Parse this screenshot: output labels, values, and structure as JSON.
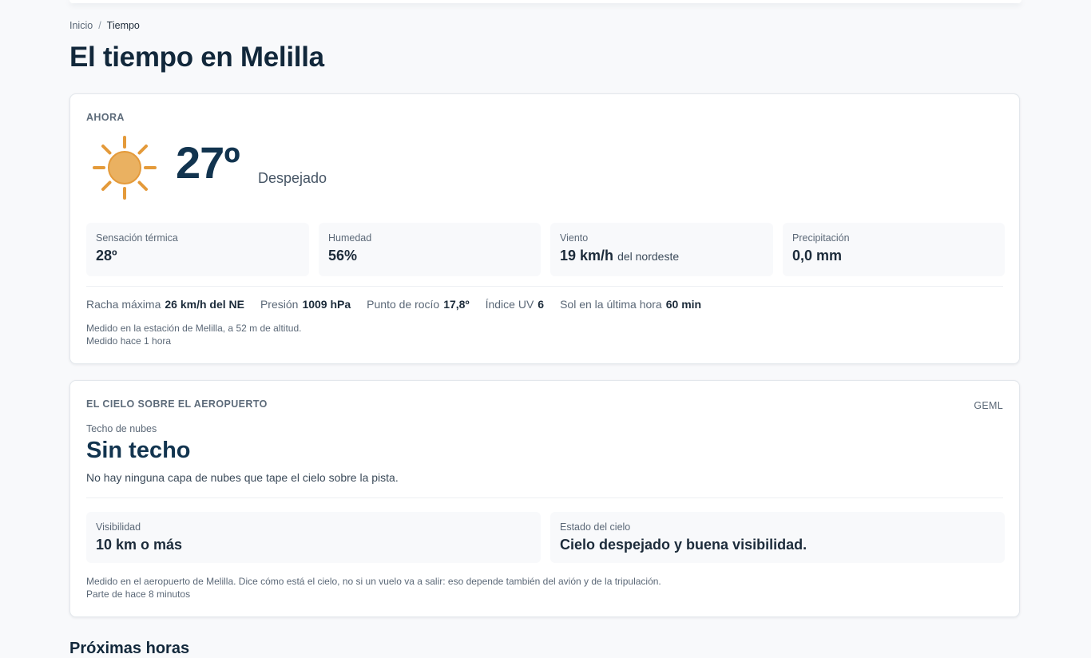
{
  "breadcrumb": {
    "home": "Inicio",
    "separator": "/",
    "current": "Tiempo"
  },
  "page_title": "El tiempo en Melilla",
  "now": {
    "section_label": "AHORA",
    "icon": "sun-icon",
    "temperature": "27º",
    "condition": "Despejado",
    "tiles": [
      {
        "label": "Sensación térmica",
        "value": "28º",
        "suffix": ""
      },
      {
        "label": "Humedad",
        "value": "56%",
        "suffix": ""
      },
      {
        "label": "Viento",
        "value": "19 km/h",
        "suffix": "del nordeste"
      },
      {
        "label": "Precipitación",
        "value": "0,0 mm",
        "suffix": ""
      }
    ],
    "metrics": [
      {
        "label": "Racha máxima",
        "value": "26 km/h del NE"
      },
      {
        "label": "Presión",
        "value": "1009 hPa"
      },
      {
        "label": "Punto de rocío",
        "value": "17,8º"
      },
      {
        "label": "Índice UV",
        "value": "6"
      },
      {
        "label": "Sol en la última hora",
        "value": "60 min"
      }
    ],
    "note_station": "Medido en la estación de Melilla, a 52 m de altitud.",
    "note_time": "Medido hace 1 hora"
  },
  "sky": {
    "section_label": "EL CIELO SOBRE EL AEROPUERTO",
    "station_code": "GEML",
    "ceiling_label": "Techo de nubes",
    "ceiling_value": "Sin techo",
    "ceiling_desc": "No hay ninguna capa de nubes que tape el cielo sobre la pista.",
    "tiles": [
      {
        "label": "Visibilidad",
        "value": "10 km o más"
      },
      {
        "label": "Estado del cielo",
        "value": "Cielo despejado y buena visibilidad."
      }
    ],
    "note_airport": "Medido en el aeropuerto de Melilla. Dice cómo está el cielo, no si un vuelo va a salir: eso depende también del avión y de la tripulación.",
    "note_time": "Parte de hace 8 minutos"
  },
  "next_hours_title": "Próximas horas",
  "colors": {
    "sun_fill": "#eab161",
    "sun_stroke": "#e49a3a",
    "heading": "#12344f"
  }
}
